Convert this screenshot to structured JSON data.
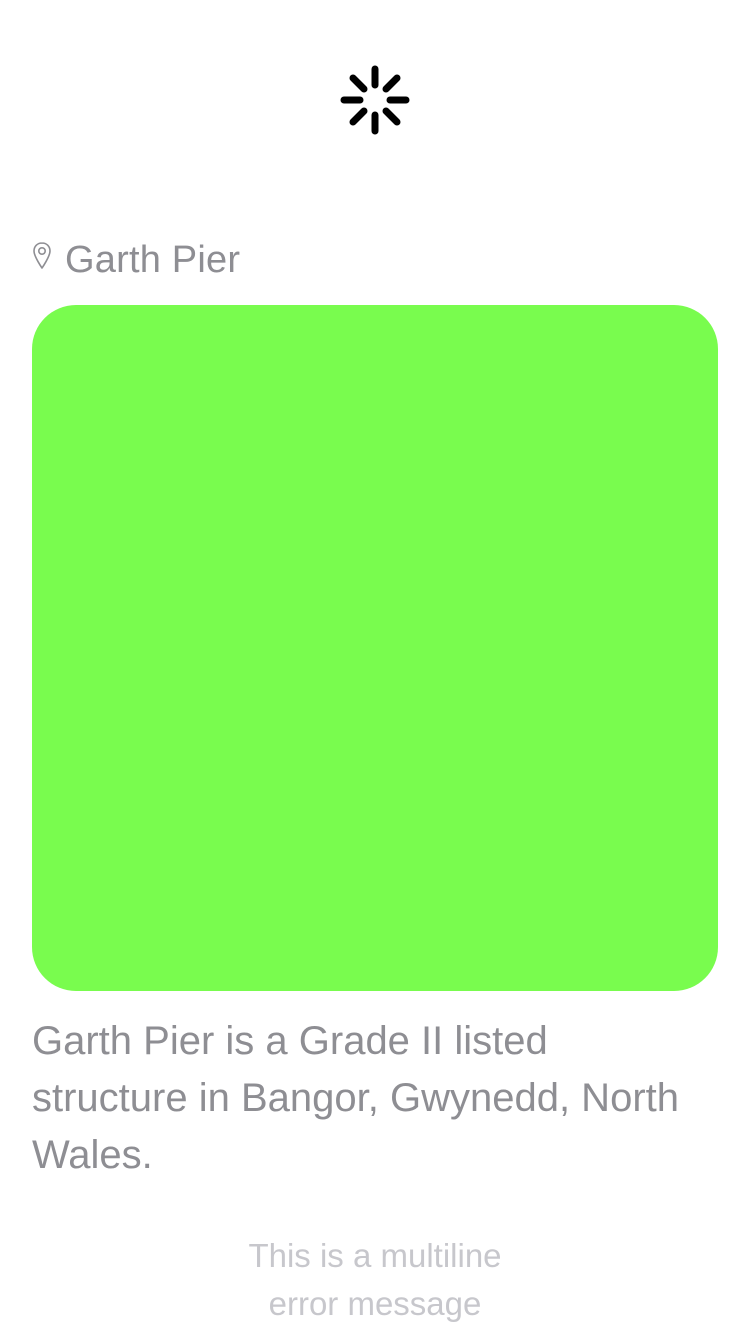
{
  "loading_indicator": {
    "icon": "activity-spinner-icon",
    "color": "#000000"
  },
  "location": {
    "icon": "map-pin-icon",
    "name": "Garth Pier"
  },
  "media": {
    "placeholder_color": "#79fc4e"
  },
  "description": "Garth Pier is a Grade II listed structure in Bangor, Gwynedd, North Wales.",
  "error_message": "This is a multiline\nerror message",
  "colors": {
    "secondary_text": "#8e8e93",
    "tertiary_text": "#c7c7cc",
    "background": "#ffffff"
  }
}
